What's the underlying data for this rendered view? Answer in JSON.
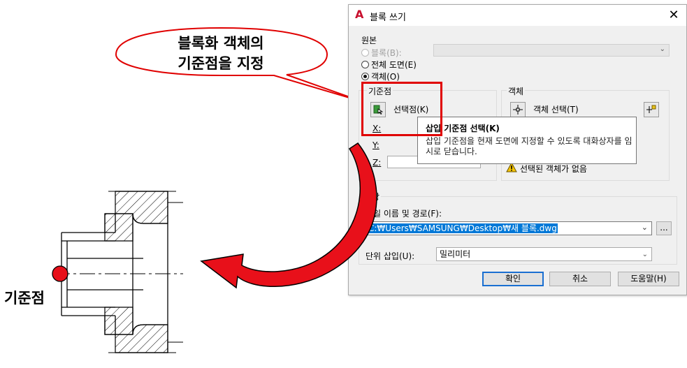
{
  "callout": {
    "line1": "블록화 객체의",
    "line2": "기준점을 지정"
  },
  "drawing": {
    "base_point_label": "기준점"
  },
  "dialog": {
    "title": "블록 쓰기",
    "close_icon": "close-icon",
    "source": {
      "label": "원본",
      "options": [
        {
          "label": "블록(B):",
          "selected": false,
          "enabled": false
        },
        {
          "label": "전체 도면(E)",
          "selected": false,
          "enabled": true
        },
        {
          "label": "객체(O)",
          "selected": true,
          "enabled": true
        }
      ]
    },
    "base_point": {
      "label": "기준점",
      "pick_label": "선택점(K)",
      "x_label": "X:",
      "y_label": "Y:",
      "z_label": "Z:"
    },
    "objects": {
      "label": "객체",
      "select_label": "객체 선택(T)",
      "status": "선택된 객체가 없음"
    },
    "destination": {
      "label": "대상",
      "path_label": "파일 이름 및 경로(F):",
      "path_value": "C:₩Users₩SAMSUNG₩Desktop₩새 블록.dwg",
      "browse_label": "...",
      "units_label": "단위 삽입(U):",
      "units_value": "밀리미터"
    },
    "buttons": {
      "ok": "확인",
      "cancel": "취소",
      "help": "도움말(H)"
    },
    "tooltip": {
      "title": "삽입 기준점 선택(K)",
      "body": "삽입 기준점을 현재 도면에 지정할 수 있도록 대화상자를 임시로 닫습니다."
    }
  },
  "colors": {
    "highlight_red": "#e00000",
    "arrow_red": "#e8101a",
    "selection_blue": "#0078d7",
    "default_button_border": "#1a6fd1"
  }
}
